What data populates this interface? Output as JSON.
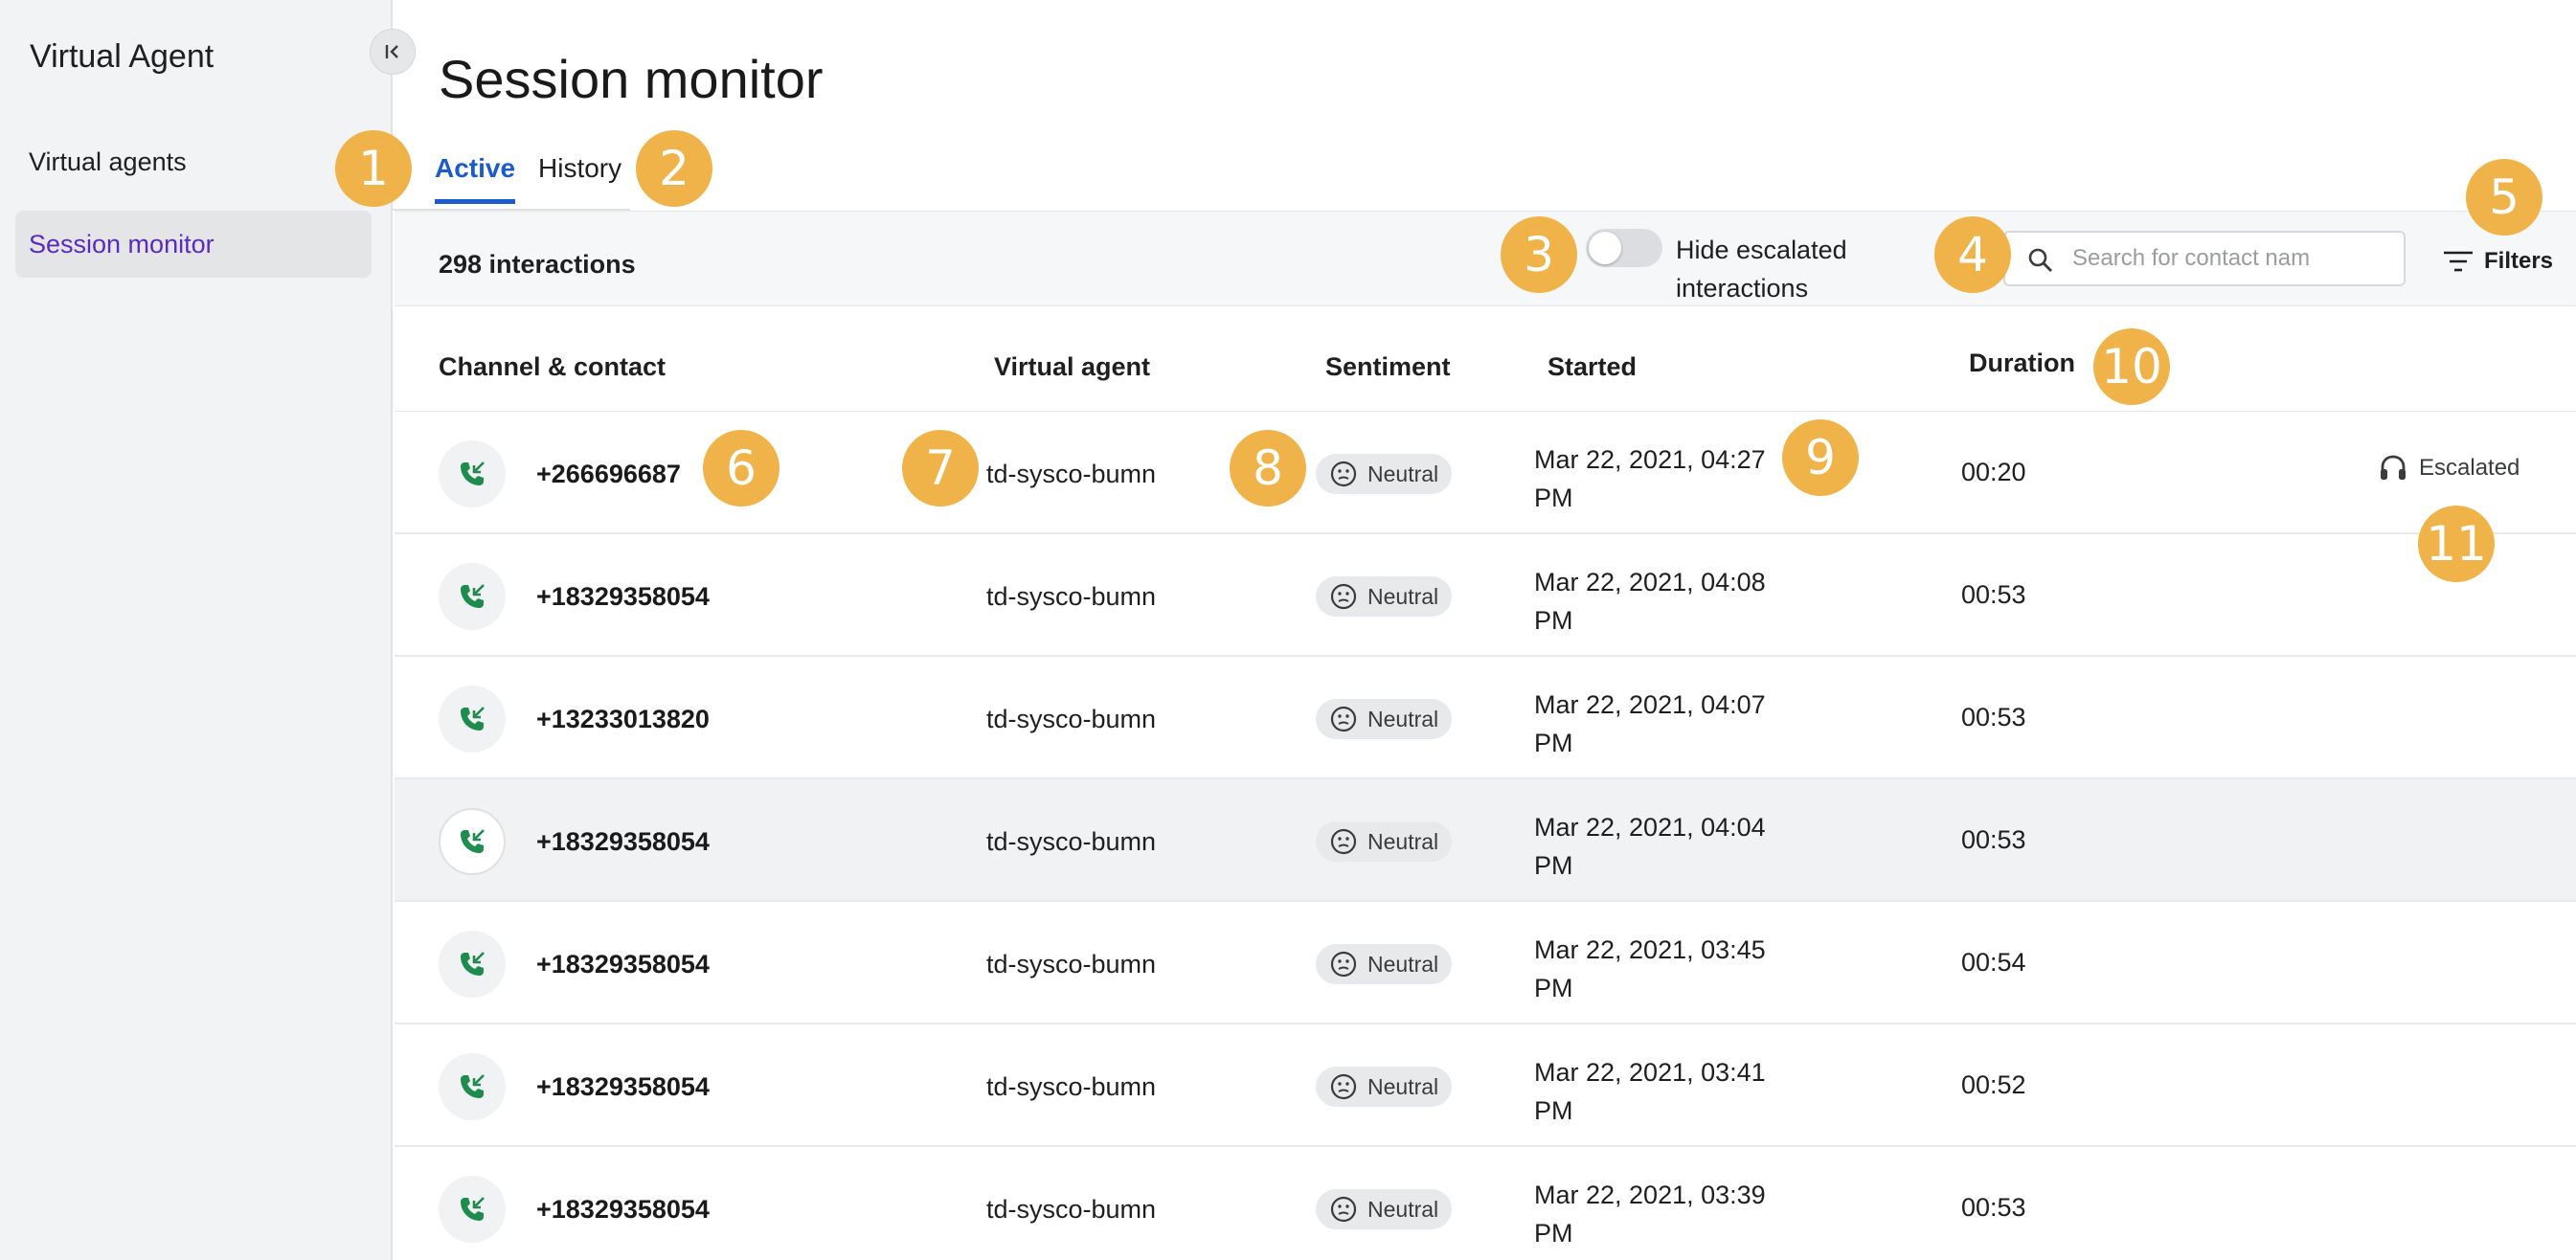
{
  "sidebar": {
    "app_title": "Virtual Agent",
    "items": [
      {
        "label": "Virtual agents",
        "active": false
      },
      {
        "label": "Session monitor",
        "active": true
      }
    ]
  },
  "page": {
    "title": "Session monitor",
    "tabs": [
      {
        "label": "Active",
        "active": true
      },
      {
        "label": "History",
        "active": false
      }
    ]
  },
  "toolbar": {
    "count_label": "298 interactions",
    "toggle_label": "Hide escalated interactions",
    "toggle_on": false,
    "search_placeholder": "Search for contact nam",
    "filters_label": "Filters"
  },
  "table": {
    "columns": [
      "Channel & contact",
      "Virtual agent",
      "Sentiment",
      "Started",
      "Duration"
    ],
    "rows": [
      {
        "contact": "+266696687",
        "agent": "td-sysco-bumn",
        "sentiment": "Neutral",
        "started_line1": "Mar 22, 2021, 04:27",
        "started_line2": "PM",
        "duration": "00:20",
        "status": "Escalated"
      },
      {
        "contact": "+18329358054",
        "agent": "td-sysco-bumn",
        "sentiment": "Neutral",
        "started_line1": "Mar 22, 2021, 04:08",
        "started_line2": "PM",
        "duration": "00:53",
        "status": ""
      },
      {
        "contact": "+13233013820",
        "agent": "td-sysco-bumn",
        "sentiment": "Neutral",
        "started_line1": "Mar 22, 2021, 04:07",
        "started_line2": "PM",
        "duration": "00:53",
        "status": ""
      },
      {
        "contact": "+18329358054",
        "agent": "td-sysco-bumn",
        "sentiment": "Neutral",
        "started_line1": "Mar 22, 2021, 04:04",
        "started_line2": "PM",
        "duration": "00:53",
        "status": ""
      },
      {
        "contact": "+18329358054",
        "agent": "td-sysco-bumn",
        "sentiment": "Neutral",
        "started_line1": "Mar 22, 2021, 03:45",
        "started_line2": "PM",
        "duration": "00:54",
        "status": ""
      },
      {
        "contact": "+18329358054",
        "agent": "td-sysco-bumn",
        "sentiment": "Neutral",
        "started_line1": "Mar 22, 2021, 03:41",
        "started_line2": "PM",
        "duration": "00:52",
        "status": ""
      },
      {
        "contact": "+18329358054",
        "agent": "td-sysco-bumn",
        "sentiment": "Neutral",
        "started_line1": "Mar 22, 2021, 03:39",
        "started_line2": "PM",
        "duration": "00:53",
        "status": ""
      }
    ]
  },
  "callouts": [
    "1",
    "2",
    "3",
    "4",
    "5",
    "6",
    "7",
    "8",
    "9",
    "10",
    "11"
  ],
  "colors": {
    "accent_tab": "#1a5ccc",
    "active_nav_text": "#5b2bc0",
    "callout": "#f0b34a",
    "channel_icon": "#1e8c4e"
  },
  "icons": {
    "collapse": "collapse-left-icon",
    "search": "search-icon",
    "filters": "filter-lines-icon",
    "channel": "incoming-call-icon",
    "sentiment": "neutral-face-icon",
    "escalated": "headset-icon"
  }
}
